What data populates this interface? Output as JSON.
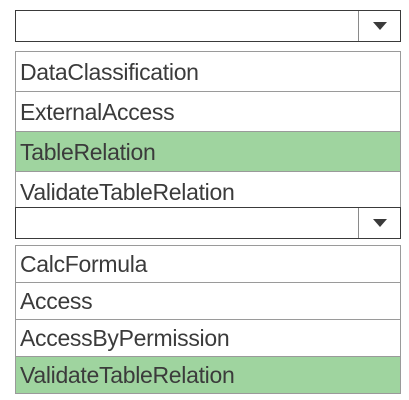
{
  "colors": {
    "selected_background": "#9fd49f",
    "border": "#3a3a3a",
    "text": "#3b3b3b"
  },
  "dropdowns": [
    {
      "icon": "chevron-down-icon",
      "options": [
        {
          "label": "DataClassification",
          "selected": false
        },
        {
          "label": "ExternalAccess",
          "selected": false
        },
        {
          "label": "TableRelation",
          "selected": true
        },
        {
          "label": "ValidateTableRelation",
          "selected": false
        }
      ]
    },
    {
      "icon": "chevron-down-icon",
      "options": [
        {
          "label": "CalcFormula",
          "selected": false
        },
        {
          "label": "Access",
          "selected": false
        },
        {
          "label": "AccessByPermission",
          "selected": false
        },
        {
          "label": "ValidateTableRelation",
          "selected": true
        }
      ]
    }
  ]
}
